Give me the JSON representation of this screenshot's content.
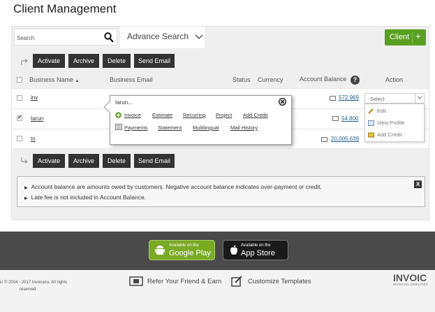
{
  "page_title": "Client Management",
  "search": {
    "placeholder": "Search",
    "advanced_label": "Advance Search"
  },
  "client_button": {
    "label": "Client",
    "plus": "+"
  },
  "toolbar": {
    "activate": "Activate",
    "archive": "Archive",
    "delete": "Delete",
    "send_email": "Send Email"
  },
  "table": {
    "headers": {
      "business_name": "Business Name",
      "sort_arrow": "▲",
      "business_email": "Business Email",
      "status": "Status",
      "currency": "Currency",
      "account_balance": "Account Balance",
      "help": "?",
      "action": "Action"
    },
    "rows": [
      {
        "name": "inv",
        "balance": "572.969",
        "checked": false
      },
      {
        "name": "tarun",
        "balance": "54.800",
        "checked": true
      },
      {
        "name": "tn",
        "balance": "20,005.639",
        "checked": false
      }
    ]
  },
  "popover": {
    "title": "tarun...",
    "links_row1": [
      "Invoice",
      "Estimate",
      "Recurring",
      "Project",
      "Add Credit"
    ],
    "links_row2": [
      "Payments",
      "Statement",
      "Multilingual",
      "Mail History"
    ]
  },
  "action_select": {
    "value": "Select",
    "menu": [
      "Edit",
      "View Profile",
      "Add Credit"
    ]
  },
  "notes": [
    "Account balance are amounts owed by customers. Negative account balance indicates over-payment or credit.",
    "Late fee is not included in Account Balance."
  ],
  "notes_close": "X",
  "stores": {
    "google": {
      "small": "Available on the",
      "big": "Google Play"
    },
    "apple": {
      "small": "Available on the",
      "big": "App Store"
    }
  },
  "bottom": {
    "copyright_1": "ic © 2004 - 2017 Invoicera. All rights",
    "copyright_2": "reserved.",
    "refer": "Refer Your Friend & Earn",
    "customize": "Customize Templates",
    "brand": "INVOIC",
    "brand_sub": "INVOICING SIMPLIFIED"
  },
  "colors": {
    "green": "#5aa020",
    "dark_button": "#333333",
    "footer": "#4a4a4a",
    "link_blue": "#1d5d8e"
  }
}
